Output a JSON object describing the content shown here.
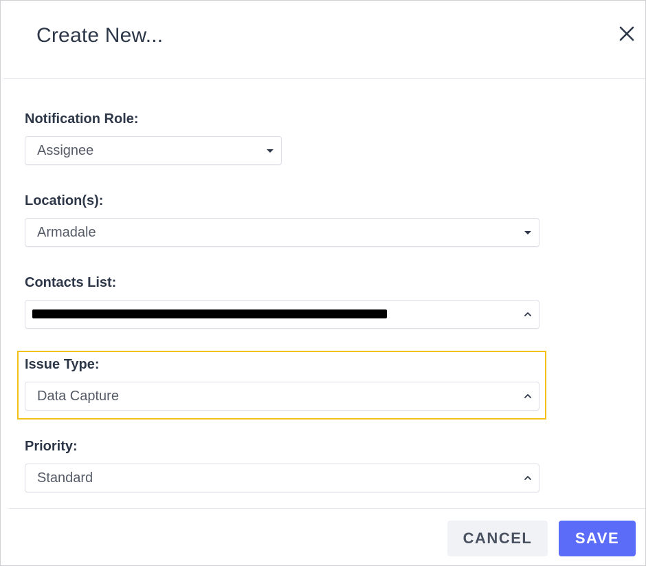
{
  "dialog": {
    "title": "Create New...",
    "close_icon": "close-icon"
  },
  "fields": {
    "notification_role": {
      "label": "Notification Role:",
      "value": "Assignee",
      "arrow": "caret-down-icon"
    },
    "locations": {
      "label": "Location(s):",
      "value": "Armadale",
      "arrow": "caret-down-icon"
    },
    "contacts_list": {
      "label": "Contacts List:",
      "value": "[redacted]",
      "arrow": "chevron-up-icon"
    },
    "issue_type": {
      "label": "Issue Type:",
      "value": "Data Capture",
      "arrow": "chevron-up-icon"
    },
    "priority": {
      "label": "Priority:",
      "value": "Standard",
      "arrow": "chevron-up-icon"
    }
  },
  "buttons": {
    "cancel_label": "CANCEL",
    "save_label": "SAVE"
  },
  "colors": {
    "accent": "#5b6cf9",
    "highlight": "#f2c21b",
    "text": "#2d3748"
  }
}
